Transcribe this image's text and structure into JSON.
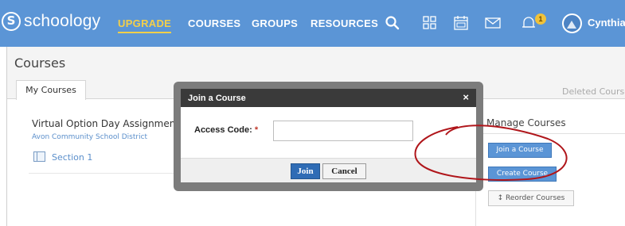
{
  "topbar": {
    "logo_text": "schoology",
    "logo_mark": "S",
    "nav": {
      "upgrade": "UPGRADE",
      "courses": "COURSES",
      "groups": "GROUPS",
      "resources": "RESOURCES"
    },
    "notification_count": "1",
    "user_name": "Cynthia ."
  },
  "page": {
    "title": "Courses",
    "tabs": {
      "my_courses": "My Courses",
      "deleted_courses": "Deleted Course"
    }
  },
  "course": {
    "title": "Virtual Option Day Assignment Ic",
    "school": "Avon Community School District",
    "section": "Section 1"
  },
  "manage": {
    "title": "Manage Courses",
    "join_label": "Join a Course",
    "create_label": "Create Course",
    "reorder_label": "↕ Reorder Courses"
  },
  "dialog": {
    "title": "Join a Course",
    "close": "×",
    "field_label": "Access Code:",
    "required_mark": "*",
    "input_value": "",
    "join_label": "Join",
    "cancel_label": "Cancel"
  },
  "colors": {
    "topbar": "#5b95d6",
    "upgrade_accent": "#f3cf4a",
    "dialog_header": "#3a3a3a",
    "annotation_circle": "#b0161b"
  }
}
